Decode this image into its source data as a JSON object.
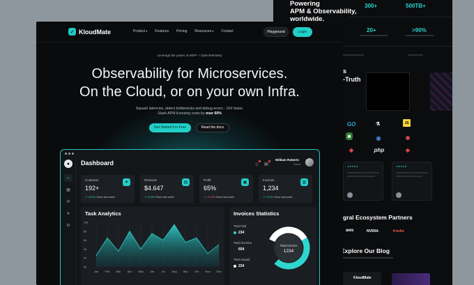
{
  "back": {
    "headline_lines": [
      "Powering",
      "APM & Observability,",
      "worldwide."
    ],
    "stats": [
      {
        "value": "300+",
        "label": ""
      },
      {
        "value": "500TB+",
        "label": ""
      },
      {
        "value": "20+",
        "label": ""
      },
      {
        "value": ">90%",
        "label": ""
      }
    ],
    "truth_heading_partial": "s",
    "truth_heading_partial2": "-Truth",
    "tech_logos": [
      "GO",
      "JS",
      "php"
    ],
    "partners_heading": "gral Ecosystem Partners",
    "partners": [
      "aws",
      "NVIDIA",
      "Kredio"
    ],
    "blog_heading": "Explore Our Blog",
    "blog_brand": "KloudMate",
    "stars": "★★★★★"
  },
  "nav": {
    "brand": "KloudMate",
    "links": [
      "Product",
      "Features",
      "Pricing",
      "Resources",
      "Contact"
    ],
    "playground": "Playground",
    "login": "Login"
  },
  "hero": {
    "eyebrow": "Leverage the power of eBPF + OpenTelemetry",
    "line1": "Observability for Microservices.",
    "line2": "On the Cloud, or on your own Infra.",
    "sub1": "Squash latencies, detect bottlenecks and debug errors - 10X faster.",
    "sub2_prefix": "Slash APM licensing costs by",
    "sub2_bold": "over 60%",
    "cta_primary": "Get Started For Free",
    "cta_secondary": "Read the docs"
  },
  "dashboard": {
    "title": "Dashboard",
    "user_name": "William Roberts",
    "user_role": "Owner",
    "kpis": [
      {
        "label": "Customer",
        "value": "192+",
        "delta": "+8.5%",
        "delta_dir": "up",
        "note": "Since last week",
        "icon": "heart-icon"
      },
      {
        "label": "Revenue",
        "value": "$4.647",
        "delta": "+8.5%",
        "delta_dir": "up",
        "note": "Since last week",
        "icon": "wallet-icon"
      },
      {
        "label": "Profit",
        "value": "65%",
        "delta": "-3.14%",
        "delta_dir": "down",
        "note": "Since last week",
        "icon": "briefcase-icon"
      },
      {
        "label": "Invoices",
        "value": "1,234",
        "delta": "+8.5%",
        "delta_dir": "up",
        "note": "Since last week",
        "icon": "document-icon"
      }
    ],
    "task_title": "Task Analytics",
    "invoices_title": "Invoices Statistics",
    "invoice_stats": [
      {
        "label": "Total Paid",
        "value": "234",
        "color": "#2fd6cf"
      },
      {
        "label": "Total Overdue",
        "value": "654",
        "color": "#1a1e22"
      },
      {
        "label": "Total Unpaid",
        "value": "234",
        "color": "#ffffff"
      }
    ],
    "donut_label": "Total Invoice",
    "donut_value": "1234",
    "donut_shares": [
      0.45,
      0.2,
      0.35
    ]
  },
  "chart_data": {
    "type": "area",
    "title": "Task Analytics",
    "categories": [
      "Jan",
      "Feb",
      "Mar",
      "Apr",
      "May",
      "Jun",
      "Jul",
      "Aug",
      "Sep",
      "Oct",
      "Nov",
      "Dec"
    ],
    "yticks": [
      "10k",
      "8k",
      "6k",
      "4k",
      "2k",
      "0k"
    ],
    "ylim": [
      0,
      10
    ],
    "series": [
      {
        "values": [
          2.5,
          6.5,
          3.5,
          8.0,
          4.0,
          7.5,
          6.0,
          9.5,
          5.5,
          6.5,
          3.0,
          5.0
        ]
      }
    ]
  },
  "colors": {
    "accent": "#22d0c8",
    "bg": "#0a0b0d",
    "panel": "#1a1e22"
  }
}
